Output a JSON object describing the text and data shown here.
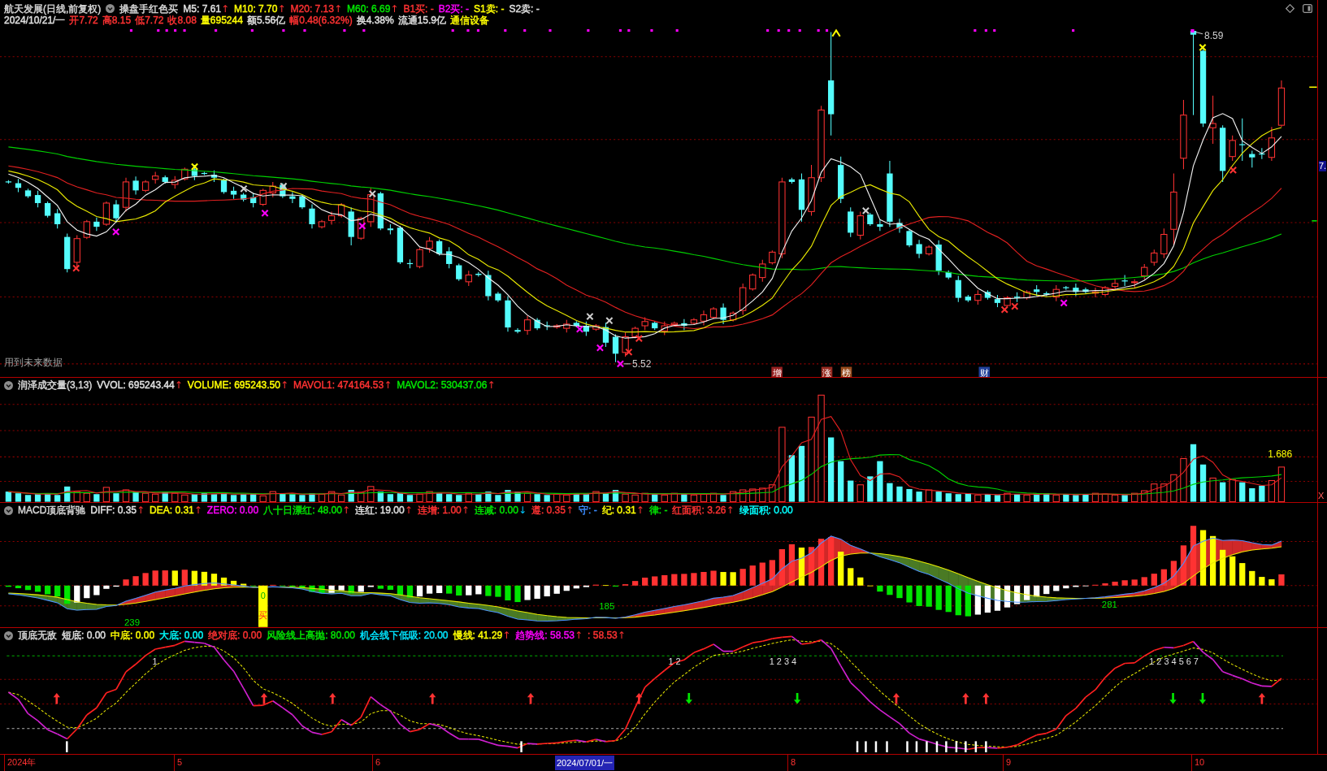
{
  "main_chart": {
    "title": "航天发展(日线,前复权)",
    "formula": "操盘手红色买",
    "indicators": [
      {
        "label": "M5: 7.61",
        "color": "#e0e0e0",
        "arrow": "↑",
        "rising": true
      },
      {
        "label": "M10: 7.70",
        "color": "#ffff00",
        "arrow": "↑",
        "rising": true
      },
      {
        "label": "M20: 7.13",
        "color": "#ff3232",
        "arrow": "↑",
        "rising": true
      },
      {
        "label": "M60: 6.69",
        "color": "#00e600",
        "arrow": "↑",
        "rising": true
      },
      {
        "label": "B1买: -",
        "color": "#ff3232"
      },
      {
        "label": "B2买: -",
        "color": "#ff00ff"
      },
      {
        "label": "S1卖: -",
        "color": "#ffff00"
      },
      {
        "label": "S2卖: -",
        "color": "#e0e0e0"
      }
    ],
    "quote": [
      {
        "label": "2024/10/21/一",
        "color": "#e0e0e0"
      },
      {
        "label": "开7.72",
        "color": "#ff3232"
      },
      {
        "label": "高8.15",
        "color": "#ff3232"
      },
      {
        "label": "低7.72",
        "color": "#ff3232"
      },
      {
        "label": "收8.08",
        "color": "#ff3232"
      },
      {
        "label": "量695244",
        "color": "#ffff00"
      },
      {
        "label": "额5.56亿",
        "color": "#e0e0e0"
      },
      {
        "label": "幅0.48(6.32%)",
        "color": "#ff3232"
      },
      {
        "label": "换4.38%",
        "color": "#e0e0e0"
      },
      {
        "label": "流通15.9亿",
        "color": "#e0e0e0"
      },
      {
        "label": "通信设备",
        "color": "#ffff00"
      }
    ],
    "high_label": "8.59",
    "low_label": "5.52",
    "warning": "用到未来数据",
    "event_tags": [
      {
        "label": "增",
        "color": "#962020"
      },
      {
        "label": "涨",
        "color": "#962a20"
      },
      {
        "label": "榜",
        "color": "#964a1c"
      },
      {
        "label": "财",
        "color": "#20409a"
      }
    ],
    "price_axis_label": "7."
  },
  "volume_panel": {
    "title": "润泽成交量(3,13)",
    "indicators": [
      {
        "label": "VVOL: 695243.44",
        "color": "#e0e0e0",
        "arrow": "↑",
        "rising": true
      },
      {
        "label": "VOLUME: 695243.50",
        "color": "#ffff00",
        "arrow": "↑",
        "rising": true
      },
      {
        "label": "MAVOL1: 474164.53",
        "color": "#ff3232",
        "arrow": "↑",
        "rising": true
      },
      {
        "label": "MAVOL2: 530437.06",
        "color": "#00e600",
        "arrow": "↑",
        "rising": true
      }
    ],
    "ratio_label": "1.686",
    "close_button": "X"
  },
  "macd_panel": {
    "title": "MACD顶底背驰",
    "indicators": [
      {
        "label": "DIFF: 0.35",
        "color": "#e0e0e0",
        "arrow": "↑",
        "rising": true
      },
      {
        "label": "DEA: 0.31",
        "color": "#ffff00",
        "arrow": "↑",
        "rising": true
      },
      {
        "label": "ZERO: 0.00",
        "color": "#ff00ff"
      },
      {
        "label": "八十日漂红: 48.00",
        "color": "#00e600",
        "arrow": "↑",
        "rising": true
      },
      {
        "label": "连红: 19.00",
        "color": "#e0e0e0",
        "arrow": "↑",
        "rising": true
      },
      {
        "label": "连增: 1.00",
        "color": "#ff3232",
        "arrow": "↑",
        "rising": true
      },
      {
        "label": "连减: 0.00",
        "color": "#00e600",
        "arrow": "↓",
        "rising": false
      },
      {
        "label": "遵: 0.35",
        "color": "#ff3232",
        "arrow": "↑",
        "rising": true
      },
      {
        "label": "守: -",
        "color": "#3c8cff"
      },
      {
        "label": "纪: 0.31",
        "color": "#ffff00",
        "arrow": "↑",
        "rising": true
      },
      {
        "label": "律: -",
        "color": "#00e600"
      },
      {
        "label": "红面积: 3.26",
        "color": "#ff3232",
        "arrow": "↑",
        "rising": true
      },
      {
        "label": "绿面积: 0.00",
        "color": "#00ffff"
      }
    ],
    "count_labels": [
      "239",
      "185",
      "281"
    ],
    "buy_marker": {
      "value": "0",
      "signal": "买"
    }
  },
  "bottom_panel": {
    "title": "顶底无敌",
    "indicators": [
      {
        "label": "短底: 0.00",
        "color": "#e0e0e0"
      },
      {
        "label": "中底: 0.00",
        "color": "#ffff00"
      },
      {
        "label": "大底: 0.00",
        "color": "#00ffff"
      },
      {
        "label": "绝对底: 0.00",
        "color": "#ff3232"
      },
      {
        "label": "风险线上高抛: 80.00",
        "color": "#00e600"
      },
      {
        "label": "机会线下低吸: 20.00",
        "color": "#00e5ff"
      },
      {
        "label": "慢线: 41.29",
        "color": "#ffff00",
        "arrow": "↑",
        "rising": true
      },
      {
        "label": "趋势线: 58.53",
        "color": "#ff00ff",
        "arrow": "↑",
        "rising": true
      },
      {
        "label": ": 58.53",
        "color": "#ff3232",
        "arrow": "↑",
        "rising": true
      }
    ],
    "sequence_labels": [
      "1",
      "1 2",
      "1 2 3 4",
      "1 2 3 4 5 6 7"
    ]
  },
  "time_axis": [
    {
      "label": "2024年",
      "selected": false
    },
    {
      "label": "5",
      "selected": false
    },
    {
      "label": "6",
      "selected": false
    },
    {
      "label": "2024/07/01/一",
      "selected": true
    },
    {
      "label": "8",
      "selected": false
    },
    {
      "label": "9",
      "selected": false
    },
    {
      "label": "10",
      "selected": false
    }
  ]
}
